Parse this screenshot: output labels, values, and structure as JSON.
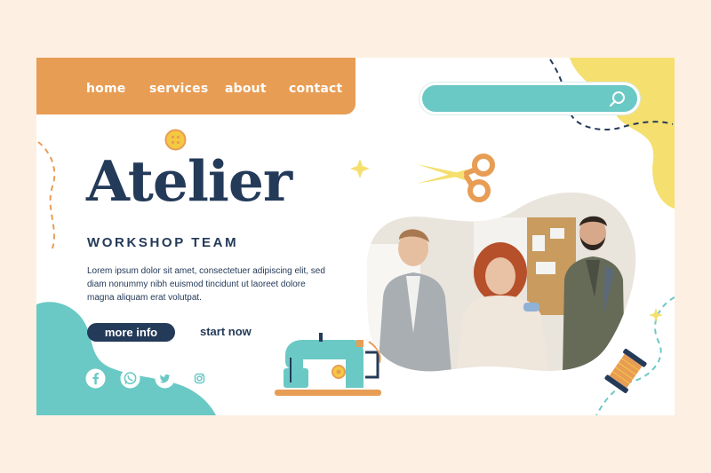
{
  "nav": {
    "items": [
      {
        "label": "home"
      },
      {
        "label": "services"
      },
      {
        "label": "about"
      },
      {
        "label": "contact"
      }
    ]
  },
  "hero": {
    "title": "Atelier",
    "subtitle": "WORKSHOP TEAM",
    "body": "Lorem ipsum dolor sit amet, consectetuer adipiscing elit, sed diam nonummy nibh euismod tincidunt ut laoreet dolore magna aliquam erat volutpat."
  },
  "actions": {
    "more_info": "more info",
    "start_now": "start now"
  },
  "social": [
    "facebook-icon",
    "whatsapp-icon",
    "twitter-icon",
    "instagram-icon"
  ],
  "colors": {
    "accent_orange": "#e89d55",
    "accent_teal": "#6ac9c5",
    "accent_yellow": "#f5df6f",
    "navy": "#243a59",
    "page_bg": "#fdf0e2"
  },
  "icons": {
    "search": "search-icon",
    "scissors": "scissors-icon",
    "button": "sewing-button-icon",
    "sewing_machine": "sewing-machine-icon",
    "thread_spool": "thread-spool-icon"
  }
}
